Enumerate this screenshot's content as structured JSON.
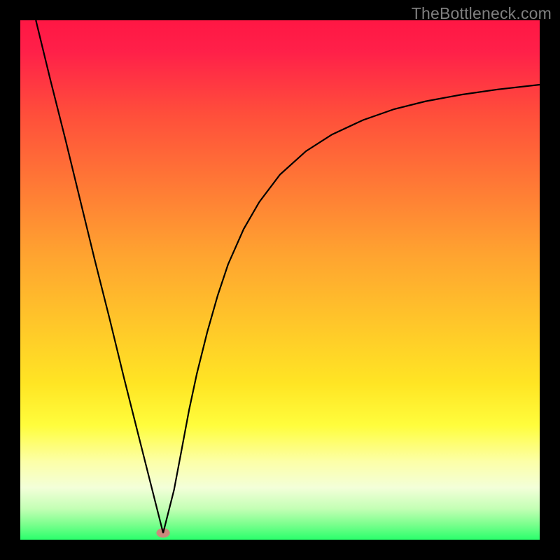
{
  "watermark": "TheBottleneck.com",
  "chart_data": {
    "type": "line",
    "title": "",
    "xlabel": "",
    "ylabel": "",
    "xlim": [
      0,
      100
    ],
    "ylim": [
      0,
      100
    ],
    "grid": false,
    "background_gradient": {
      "type": "vertical",
      "stops": [
        {
          "offset": 0.0,
          "color": "#ff1744"
        },
        {
          "offset": 0.06,
          "color": "#ff2049"
        },
        {
          "offset": 0.18,
          "color": "#ff4e3b"
        },
        {
          "offset": 0.45,
          "color": "#ffa330"
        },
        {
          "offset": 0.7,
          "color": "#ffe524"
        },
        {
          "offset": 0.78,
          "color": "#fffd3c"
        },
        {
          "offset": 0.85,
          "color": "#fcffa8"
        },
        {
          "offset": 0.9,
          "color": "#f3ffd9"
        },
        {
          "offset": 0.94,
          "color": "#c4ffb5"
        },
        {
          "offset": 0.97,
          "color": "#7cff8e"
        },
        {
          "offset": 1.0,
          "color": "#2aff6c"
        }
      ]
    },
    "marker": {
      "x": 27.5,
      "y": 1.3,
      "color": "#cc8a7c",
      "rx": 1.3,
      "ry": 0.9
    },
    "series": [
      {
        "name": "curve",
        "color": "#000000",
        "x": [
          3.0,
          5.8,
          8.7,
          11.5,
          14.3,
          17.2,
          20.0,
          22.9,
          25.4,
          27.5,
          29.6,
          31.0,
          32.5,
          34.0,
          36.0,
          38.0,
          40.0,
          43.0,
          46.0,
          50.0,
          55.0,
          60.0,
          66.0,
          72.0,
          78.0,
          85.0,
          92.0,
          100.0
        ],
        "y": [
          100.0,
          88.5,
          77.0,
          65.5,
          54.0,
          42.5,
          31.0,
          19.5,
          9.6,
          1.3,
          9.6,
          17.0,
          25.0,
          32.0,
          40.0,
          47.0,
          53.0,
          59.8,
          65.0,
          70.3,
          74.8,
          78.0,
          80.8,
          82.9,
          84.4,
          85.7,
          86.7,
          87.6
        ]
      }
    ]
  }
}
